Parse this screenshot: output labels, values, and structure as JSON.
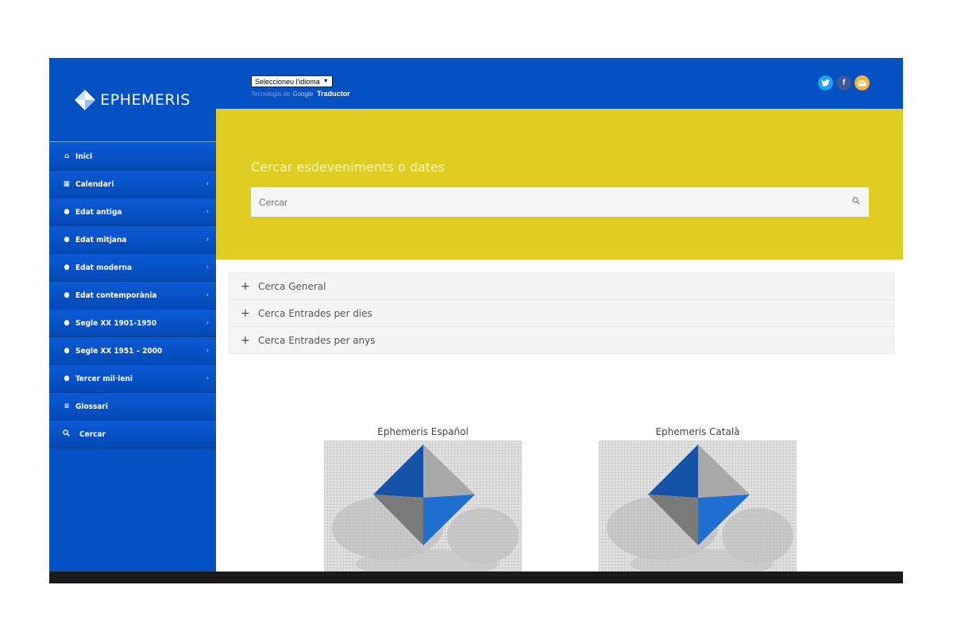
{
  "brand": {
    "logo_text": "EPHEMERIS"
  },
  "header": {
    "language_select": "Seleccioneu l'idioma",
    "powered_by_prefix": "Tecnologia de",
    "powered_by_google": "Google",
    "powered_by_translator": "Traductor",
    "social": [
      "twitter-icon",
      "facebook-icon",
      "email-icon"
    ]
  },
  "sidebar": {
    "items": [
      {
        "label": "Inici",
        "icon": "home-icon",
        "has_submenu": false
      },
      {
        "label": "Calendari",
        "icon": "calendar-icon",
        "has_submenu": true
      },
      {
        "label": "Edat antiga",
        "icon": "globe-icon",
        "has_submenu": true
      },
      {
        "label": "Edat mitjana",
        "icon": "globe-icon",
        "has_submenu": true
      },
      {
        "label": "Edat moderna",
        "icon": "globe-icon",
        "has_submenu": true
      },
      {
        "label": "Edat contemporània",
        "icon": "globe-icon",
        "has_submenu": true
      },
      {
        "label": "Segle XX 1901-1950",
        "icon": "globe-icon",
        "has_submenu": true
      },
      {
        "label": "Segle XX 1951 – 2000",
        "icon": "globe-icon",
        "has_submenu": true
      },
      {
        "label": "Tercer mil·leni",
        "icon": "globe-icon",
        "has_submenu": true
      },
      {
        "label": "Glossari",
        "icon": "list-icon",
        "has_submenu": false
      },
      {
        "label": "Cercar",
        "icon": "search-icon",
        "has_submenu": false
      }
    ]
  },
  "hero": {
    "title": "Cercar esdeveniments o dates",
    "search_placeholder": "Cercar"
  },
  "accordion": {
    "items": [
      "Cerca General",
      "Cerca Entrades per dies",
      "Cerca Entrades per anys"
    ]
  },
  "cards": [
    {
      "title": "Ephemeris Español"
    },
    {
      "title": "Ephemeris Català"
    }
  ],
  "colors": {
    "primary_blue": "#0451c4",
    "hero_yellow": "#dfcd22",
    "accordion_bg": "#f4f4f4",
    "footer": "#1b1b1b"
  }
}
